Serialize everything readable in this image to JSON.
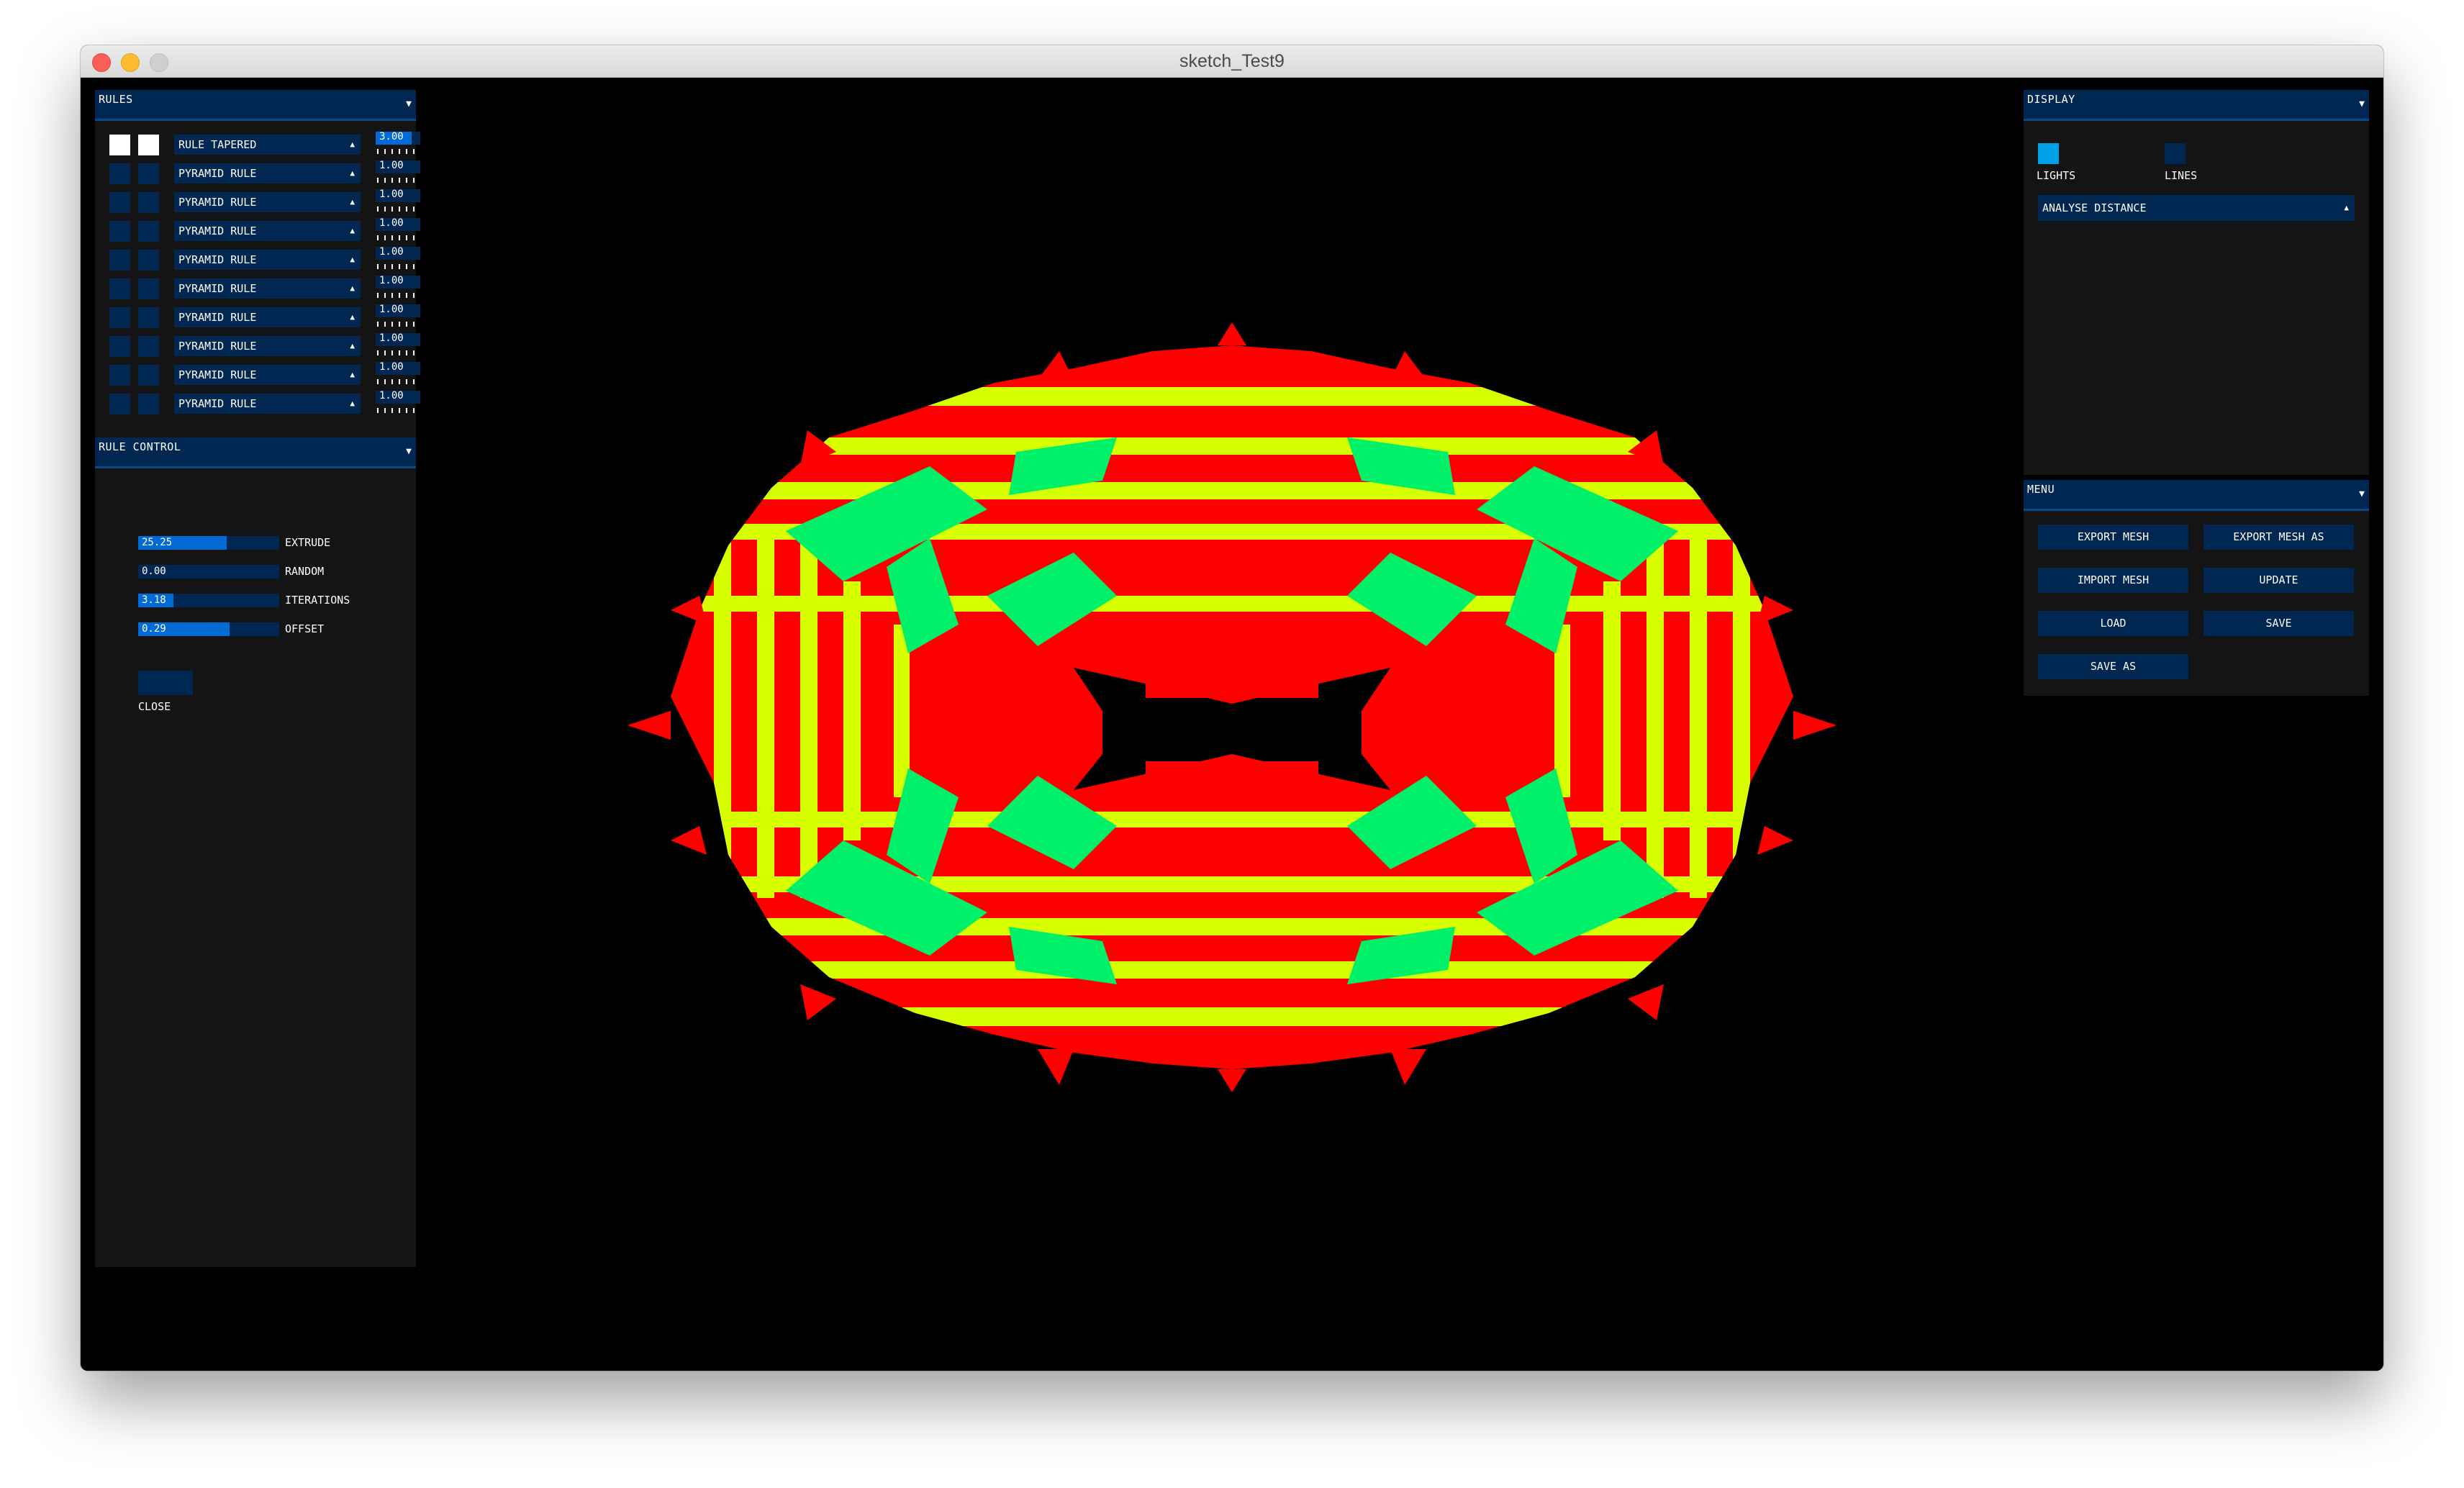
{
  "window": {
    "title": "sketch_Test9"
  },
  "rules_panel": {
    "title": "RULES",
    "rows": [
      {
        "rule": "RULE TAPERED",
        "value": "3.00",
        "fill": 0.8,
        "active": true
      },
      {
        "rule": "PYRAMID RULE",
        "value": "1.00",
        "fill": 0,
        "active": false
      },
      {
        "rule": "PYRAMID RULE",
        "value": "1.00",
        "fill": 0,
        "active": false
      },
      {
        "rule": "PYRAMID RULE",
        "value": "1.00",
        "fill": 0,
        "active": false
      },
      {
        "rule": "PYRAMID RULE",
        "value": "1.00",
        "fill": 0,
        "active": false
      },
      {
        "rule": "PYRAMID RULE",
        "value": "1.00",
        "fill": 0,
        "active": false
      },
      {
        "rule": "PYRAMID RULE",
        "value": "1.00",
        "fill": 0,
        "active": false
      },
      {
        "rule": "PYRAMID RULE",
        "value": "1.00",
        "fill": 0,
        "active": false
      },
      {
        "rule": "PYRAMID RULE",
        "value": "1.00",
        "fill": 0,
        "active": false
      },
      {
        "rule": "PYRAMID RULE",
        "value": "1.00",
        "fill": 0,
        "active": false
      }
    ]
  },
  "rule_control": {
    "title": "RULE CONTROL",
    "sliders": [
      {
        "label": "EXTRUDE",
        "value": "25.25",
        "fill": 0.63
      },
      {
        "label": "RANDOM",
        "value": "0.00",
        "fill": 0
      },
      {
        "label": "ITERATIONS",
        "value": "3.18",
        "fill": 0.25
      },
      {
        "label": "OFFSET",
        "value": "0.29",
        "fill": 0.65
      }
    ],
    "close_label": "CLOSE"
  },
  "display_panel": {
    "title": "DISPLAY",
    "lights_label": "LIGHTS",
    "lights_on": true,
    "lines_label": "LINES",
    "lines_on": false,
    "analysis_select": "ANALYSE DISTANCE"
  },
  "menu_panel": {
    "title": "MENU",
    "buttons": [
      "EXPORT MESH",
      "EXPORT MESH AS",
      "IMPORT MESH",
      "UPDATE",
      "LOAD",
      "SAVE",
      "SAVE AS"
    ]
  },
  "colors": {
    "panel_header": "#002652",
    "active_fill": "#016ad4",
    "toggle_on": "#00a0e6",
    "mesh_red": "#ff0000",
    "mesh_yellow": "#d8ff00",
    "mesh_green": "#00f06a"
  },
  "icons": {
    "collapse": "chevron-down-icon",
    "dropdown": "caret-up-icon"
  }
}
